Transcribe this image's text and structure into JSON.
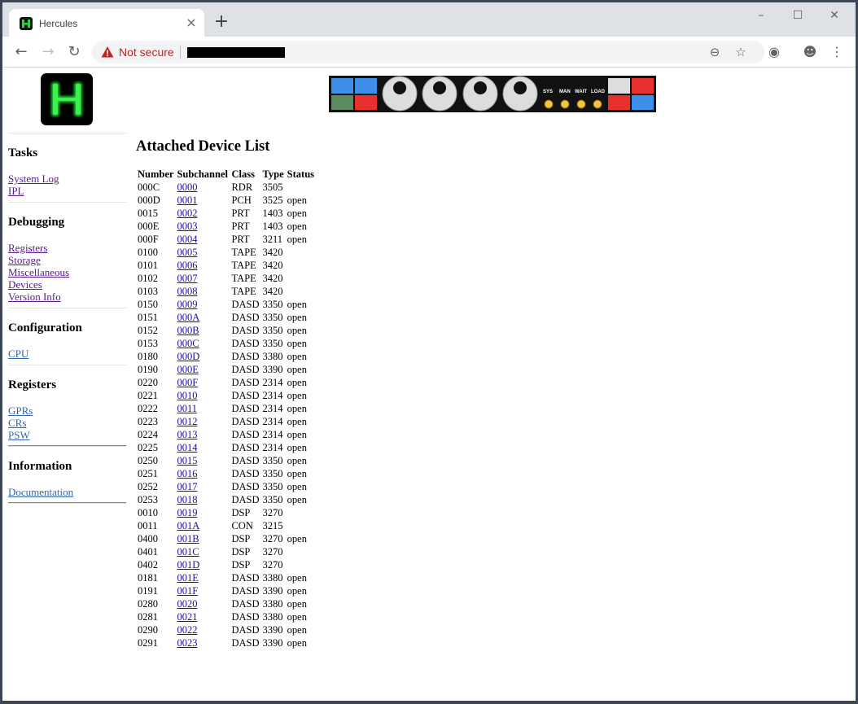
{
  "browser": {
    "tab_title": "Hercules",
    "tab_close_icon": "close-icon",
    "new_tab_icon": "plus-icon",
    "security_label": "Not secure",
    "controls": {
      "minimize": "–",
      "maximize": "☐",
      "close": "✕"
    }
  },
  "sidebar": {
    "sections": [
      {
        "title": "Tasks",
        "links": [
          "System Log",
          "IPL"
        ]
      },
      {
        "title": "Debugging",
        "links": [
          "Registers",
          "Storage",
          "Miscellaneous",
          "Devices",
          "Version Info"
        ]
      },
      {
        "title": "Configuration",
        "links": [
          "CPU"
        ]
      },
      {
        "title": "Registers",
        "links": [
          "GPRs",
          "CRs",
          "PSW"
        ]
      },
      {
        "title": "Information",
        "links": [
          "Documentation"
        ]
      }
    ]
  },
  "panel": {
    "indicators": [
      "SYS",
      "MAN",
      "WAIT",
      "LOAD"
    ]
  },
  "main": {
    "title": "Attached Device List",
    "columns": [
      "Number",
      "Subchannel",
      "Class",
      "Type",
      "Status"
    ],
    "rows": [
      [
        "000C",
        "0000",
        "RDR",
        "3505",
        ""
      ],
      [
        "000D",
        "0001",
        "PCH",
        "3525",
        "open"
      ],
      [
        "0015",
        "0002",
        "PRT",
        "1403",
        "open"
      ],
      [
        "000E",
        "0003",
        "PRT",
        "1403",
        "open"
      ],
      [
        "000F",
        "0004",
        "PRT",
        "3211",
        "open"
      ],
      [
        "0100",
        "0005",
        "TAPE",
        "3420",
        ""
      ],
      [
        "0101",
        "0006",
        "TAPE",
        "3420",
        ""
      ],
      [
        "0102",
        "0007",
        "TAPE",
        "3420",
        ""
      ],
      [
        "0103",
        "0008",
        "TAPE",
        "3420",
        ""
      ],
      [
        "0150",
        "0009",
        "DASD",
        "3350",
        "open"
      ],
      [
        "0151",
        "000A",
        "DASD",
        "3350",
        "open"
      ],
      [
        "0152",
        "000B",
        "DASD",
        "3350",
        "open"
      ],
      [
        "0153",
        "000C",
        "DASD",
        "3350",
        "open"
      ],
      [
        "0180",
        "000D",
        "DASD",
        "3380",
        "open"
      ],
      [
        "0190",
        "000E",
        "DASD",
        "3390",
        "open"
      ],
      [
        "0220",
        "000F",
        "DASD",
        "2314",
        "open"
      ],
      [
        "0221",
        "0010",
        "DASD",
        "2314",
        "open"
      ],
      [
        "0222",
        "0011",
        "DASD",
        "2314",
        "open"
      ],
      [
        "0223",
        "0012",
        "DASD",
        "2314",
        "open"
      ],
      [
        "0224",
        "0013",
        "DASD",
        "2314",
        "open"
      ],
      [
        "0225",
        "0014",
        "DASD",
        "2314",
        "open"
      ],
      [
        "0250",
        "0015",
        "DASD",
        "3350",
        "open"
      ],
      [
        "0251",
        "0016",
        "DASD",
        "3350",
        "open"
      ],
      [
        "0252",
        "0017",
        "DASD",
        "3350",
        "open"
      ],
      [
        "0253",
        "0018",
        "DASD",
        "3350",
        "open"
      ],
      [
        "0010",
        "0019",
        "DSP",
        "3270",
        ""
      ],
      [
        "0011",
        "001A",
        "CON",
        "3215",
        ""
      ],
      [
        "0400",
        "001B",
        "DSP",
        "3270",
        "open"
      ],
      [
        "0401",
        "001C",
        "DSP",
        "3270",
        ""
      ],
      [
        "0402",
        "001D",
        "DSP",
        "3270",
        ""
      ],
      [
        "0181",
        "001E",
        "DASD",
        "3380",
        "open"
      ],
      [
        "0191",
        "001F",
        "DASD",
        "3390",
        "open"
      ],
      [
        "0280",
        "0020",
        "DASD",
        "3380",
        "open"
      ],
      [
        "0281",
        "0021",
        "DASD",
        "3380",
        "open"
      ],
      [
        "0290",
        "0022",
        "DASD",
        "3390",
        "open"
      ],
      [
        "0291",
        "0023",
        "DASD",
        "3390",
        "open"
      ]
    ]
  }
}
